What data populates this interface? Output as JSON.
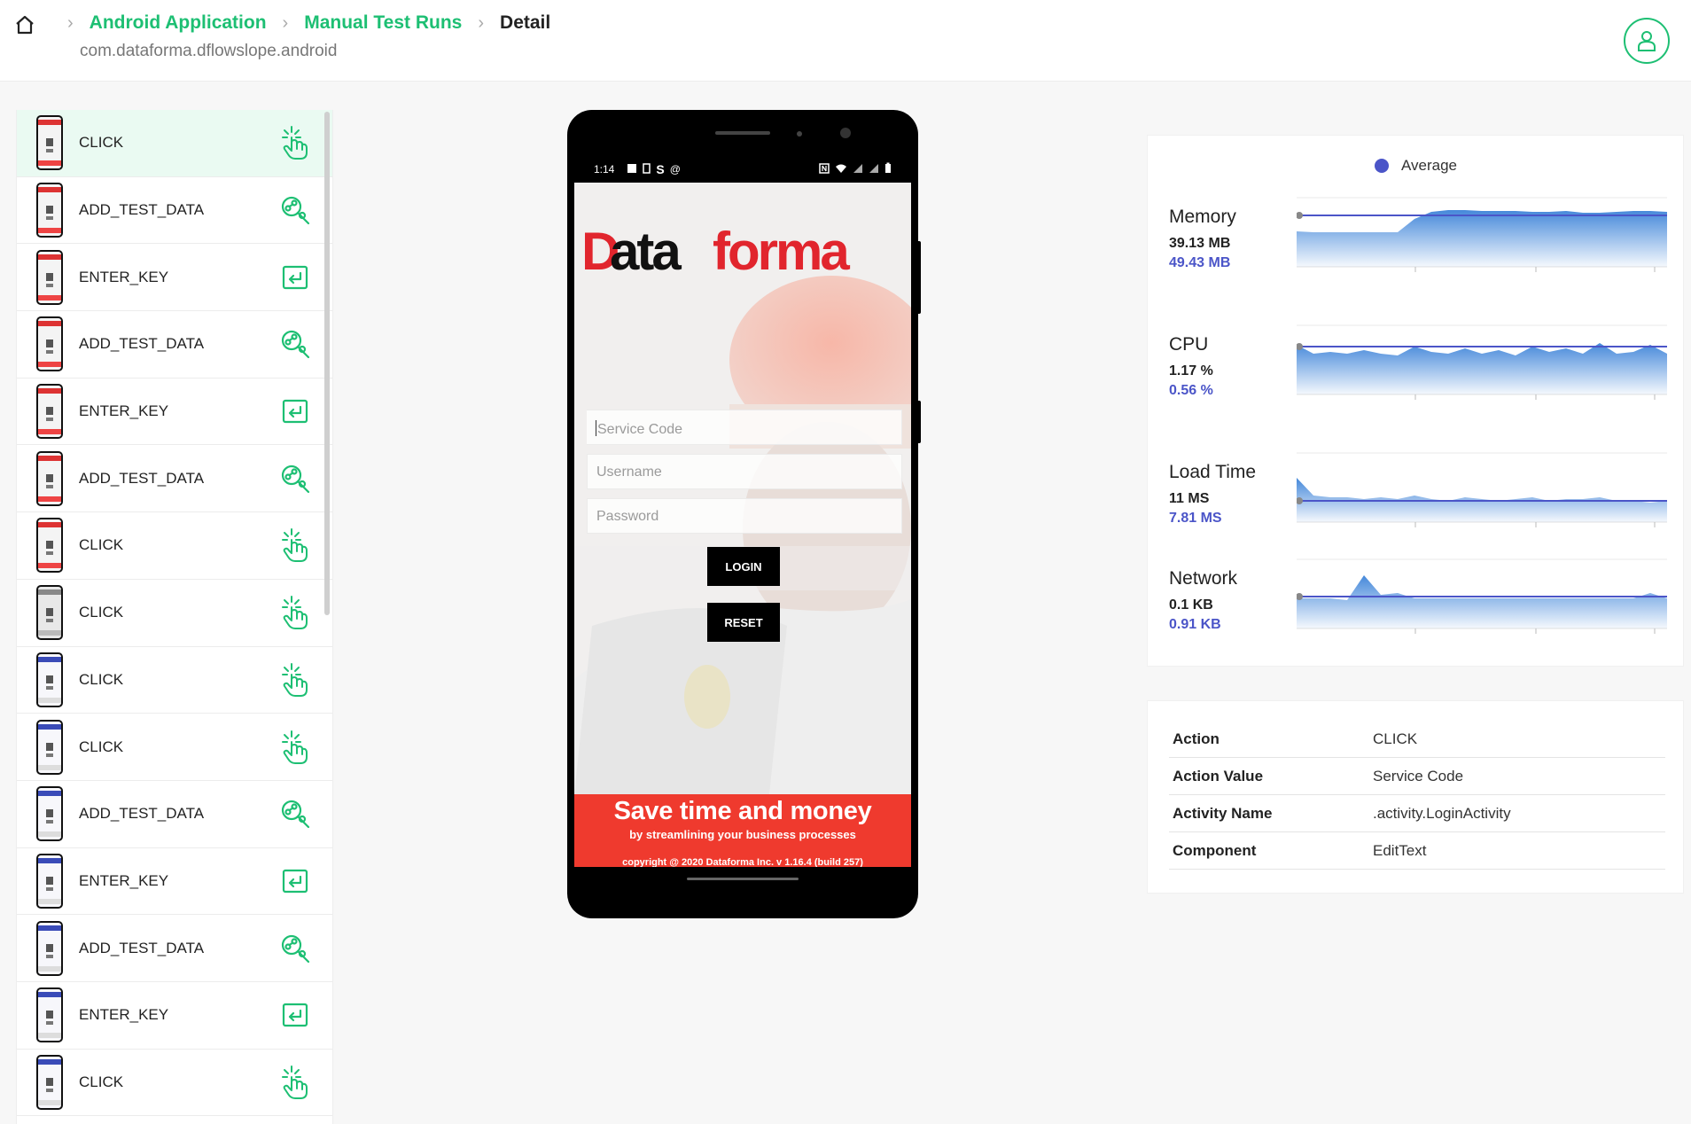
{
  "breadcrumb": {
    "items": [
      "Android Application",
      "Manual Test Runs",
      "Detail"
    ],
    "package": "com.dataforma.dflowslope.android"
  },
  "steps": [
    {
      "label": "CLICK",
      "icon": "tap-icon",
      "thumb": "red"
    },
    {
      "label": "ADD_TEST_DATA",
      "icon": "add-data-icon",
      "thumb": "red"
    },
    {
      "label": "ENTER_KEY",
      "icon": "enter-key-icon",
      "thumb": "red"
    },
    {
      "label": "ADD_TEST_DATA",
      "icon": "add-data-icon",
      "thumb": "red"
    },
    {
      "label": "ENTER_KEY",
      "icon": "enter-key-icon",
      "thumb": "red"
    },
    {
      "label": "ADD_TEST_DATA",
      "icon": "add-data-icon",
      "thumb": "red"
    },
    {
      "label": "CLICK",
      "icon": "tap-icon",
      "thumb": "red"
    },
    {
      "label": "CLICK",
      "icon": "tap-icon",
      "thumb": "grid"
    },
    {
      "label": "CLICK",
      "icon": "tap-icon",
      "thumb": "blue"
    },
    {
      "label": "CLICK",
      "icon": "tap-icon",
      "thumb": "blue"
    },
    {
      "label": "ADD_TEST_DATA",
      "icon": "add-data-icon",
      "thumb": "blue"
    },
    {
      "label": "ENTER_KEY",
      "icon": "enter-key-icon",
      "thumb": "blue"
    },
    {
      "label": "ADD_TEST_DATA",
      "icon": "add-data-icon",
      "thumb": "blue"
    },
    {
      "label": "ENTER_KEY",
      "icon": "enter-key-icon",
      "thumb": "blue"
    },
    {
      "label": "CLICK",
      "icon": "tap-icon",
      "thumb": "blue"
    }
  ],
  "phone": {
    "time": "1:14",
    "logo_d": "D",
    "logo_ata": "ata",
    "logo_forma": "forma",
    "service_code_placeholder": "Service Code",
    "username_placeholder": "Username",
    "password_placeholder": "Password",
    "login_label": "LOGIN",
    "reset_label": "RESET",
    "banner_title": "Save time and money",
    "banner_sub": "by streamlining your business processes",
    "banner_copy": "copyright @ 2020 Dataforma Inc. v 1.16.4 (build 257)"
  },
  "metrics": {
    "legend": "Average",
    "colors": {
      "accent": "#1dbf73",
      "average": "#4b55c8",
      "fill": "#3b82d8"
    },
    "items": [
      {
        "name": "Memory",
        "current": "39.13 MB",
        "average": "49.43 MB"
      },
      {
        "name": "CPU",
        "current": "1.17 %",
        "average": "0.56 %"
      },
      {
        "name": "Load Time",
        "current": "11 MS",
        "average": "7.81 MS"
      },
      {
        "name": "Network",
        "current": "0.1 KB",
        "average": "0.91 KB"
      }
    ]
  },
  "details": [
    {
      "key": "Action",
      "value": "CLICK"
    },
    {
      "key": "Action Value",
      "value": "Service Code"
    },
    {
      "key": "Activity Name",
      "value": ".activity.LoginActivity"
    },
    {
      "key": "Component",
      "value": "EditText"
    }
  ]
}
